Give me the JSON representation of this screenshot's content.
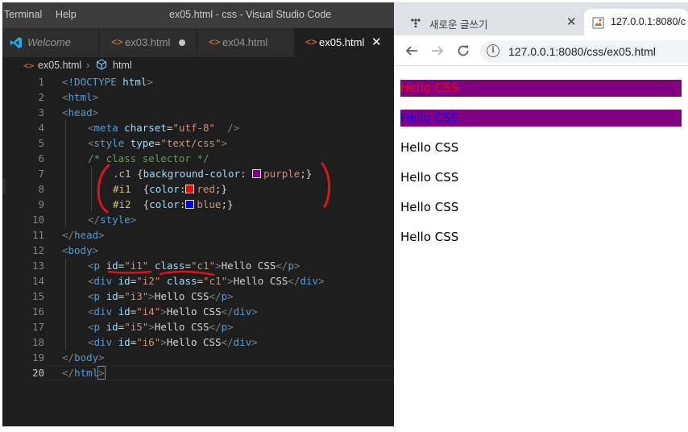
{
  "vscode": {
    "menu": [
      "Terminal",
      "Help"
    ],
    "title": "ex05.html - css - Visual Studio Code",
    "tabs": [
      {
        "label": "Welcome",
        "icon": "vscode-logo-icon"
      },
      {
        "label": "ex03.html",
        "icon": "html-file-icon",
        "modified": true
      },
      {
        "label": "ex04.html",
        "icon": "html-file-icon"
      },
      {
        "label": "ex05.html",
        "icon": "html-file-icon",
        "active": true
      }
    ],
    "breadcrumb": [
      "ex05.html",
      "html"
    ],
    "line_numbers": [
      "1",
      "2",
      "3",
      "4",
      "5",
      "6",
      "7",
      "8",
      "9",
      "10",
      "11",
      "12",
      "13",
      "14",
      "15",
      "16",
      "17",
      "18",
      "19",
      "20"
    ],
    "code": {
      "l1": {
        "br1": "<",
        "doctype": "!DOCTYPE",
        "name": "html",
        "br2": ">"
      },
      "l2": {
        "br1": "<",
        "tag": "html",
        "br2": ">"
      },
      "l3": {
        "br1": "<",
        "tag": "head",
        "br2": ">"
      },
      "l4": {
        "br1": "<",
        "tag": "meta",
        "attr": "charset",
        "eq": "=",
        "val": "\"utf-8\"",
        "br2": "/>"
      },
      "l5": {
        "br1": "<",
        "tag": "style",
        "attr": "type",
        "eq": "=",
        "val": "\"text/css\"",
        "br2": ">"
      },
      "l6": {
        "comment": "/* class selector */"
      },
      "l7": {
        "sel": ".c1",
        "open": "{",
        "prop": "background-color",
        "colon": ":",
        "val": "purple",
        "close": ";}"
      },
      "l8": {
        "sel": "#i1",
        "open": "{",
        "prop": "color",
        "colon": ":",
        "val": "red",
        "close": ";}"
      },
      "l9": {
        "sel": "#i2",
        "open": "{",
        "prop": "color",
        "colon": ":",
        "val": "blue",
        "close": ";}"
      },
      "l10": {
        "br1": "</",
        "tag": "style",
        "br2": ">"
      },
      "l11": {
        "br1": "</",
        "tag": "head",
        "br2": ">"
      },
      "l12": {
        "br1": "<",
        "tag": "body",
        "br2": ">"
      },
      "l13": {
        "br1": "<",
        "tag": "p",
        "a1": "id",
        "v1": "\"i1\"",
        "a2": "class",
        "v2": "\"c1\"",
        "br2": ">",
        "text": "Hello CSS",
        "br3": "</",
        "tag2": "p",
        "br4": ">"
      },
      "l14": {
        "br1": "<",
        "tag": "div",
        "a1": "id",
        "v1": "\"i2\"",
        "a2": "class",
        "v2": "\"c1\"",
        "br2": ">",
        "text": "Hello CSS",
        "br3": "</",
        "tag2": "div",
        "br4": ">"
      },
      "l15": {
        "br1": "<",
        "tag": "p",
        "a1": "id",
        "v1": "\"i3\"",
        "br2": ">",
        "text": "Hello CSS",
        "br3": "</",
        "tag2": "p",
        "br4": ">"
      },
      "l16": {
        "br1": "<",
        "tag": "div",
        "a1": "id",
        "v1": "\"i4\"",
        "br2": ">",
        "text": "Hello CSS",
        "br3": "</",
        "tag2": "div",
        "br4": ">"
      },
      "l17": {
        "br1": "<",
        "tag": "p",
        "a1": "id",
        "v1": "\"i5\"",
        "br2": ">",
        "text": "Hello CSS",
        "br3": "</",
        "tag2": "p",
        "br4": ">"
      },
      "l18": {
        "br1": "<",
        "tag": "div",
        "a1": "id",
        "v1": "\"i6\"",
        "br2": ">",
        "text": "Hello CSS",
        "br3": "</",
        "tag2": "div",
        "br4": ">"
      },
      "l19": {
        "br1": "</",
        "tag": "body",
        "br2": ">"
      },
      "l20": {
        "br1": "</",
        "tag": "html",
        "br2": ">"
      }
    },
    "swatch_colors": {
      "purple": "#800080",
      "red": "#ff0000",
      "blue": "#0000ff"
    },
    "annotation_color": "#d4181c"
  },
  "browser": {
    "tabs": [
      {
        "label": "새로운 글쓰기",
        "icon": "dots-favicon-icon"
      },
      {
        "label": "127.0.0.1:8080/c",
        "icon": "page-favicon-icon",
        "active": true
      }
    ],
    "close_glyph": "✕",
    "url": "127.0.0.1:8080/css/ex05.html",
    "info_glyph": "i",
    "rendered": [
      {
        "text": "Hello CSS",
        "color": "#ff0000",
        "background": "#800080"
      },
      {
        "text": "Hello CSS",
        "color": "#0000ff",
        "background": "#800080"
      },
      {
        "text": "Hello CSS",
        "color": "#000000"
      },
      {
        "text": "Hello CSS",
        "color": "#000000"
      },
      {
        "text": "Hello CSS",
        "color": "#000000"
      },
      {
        "text": "Hello CSS",
        "color": "#000000"
      }
    ]
  }
}
